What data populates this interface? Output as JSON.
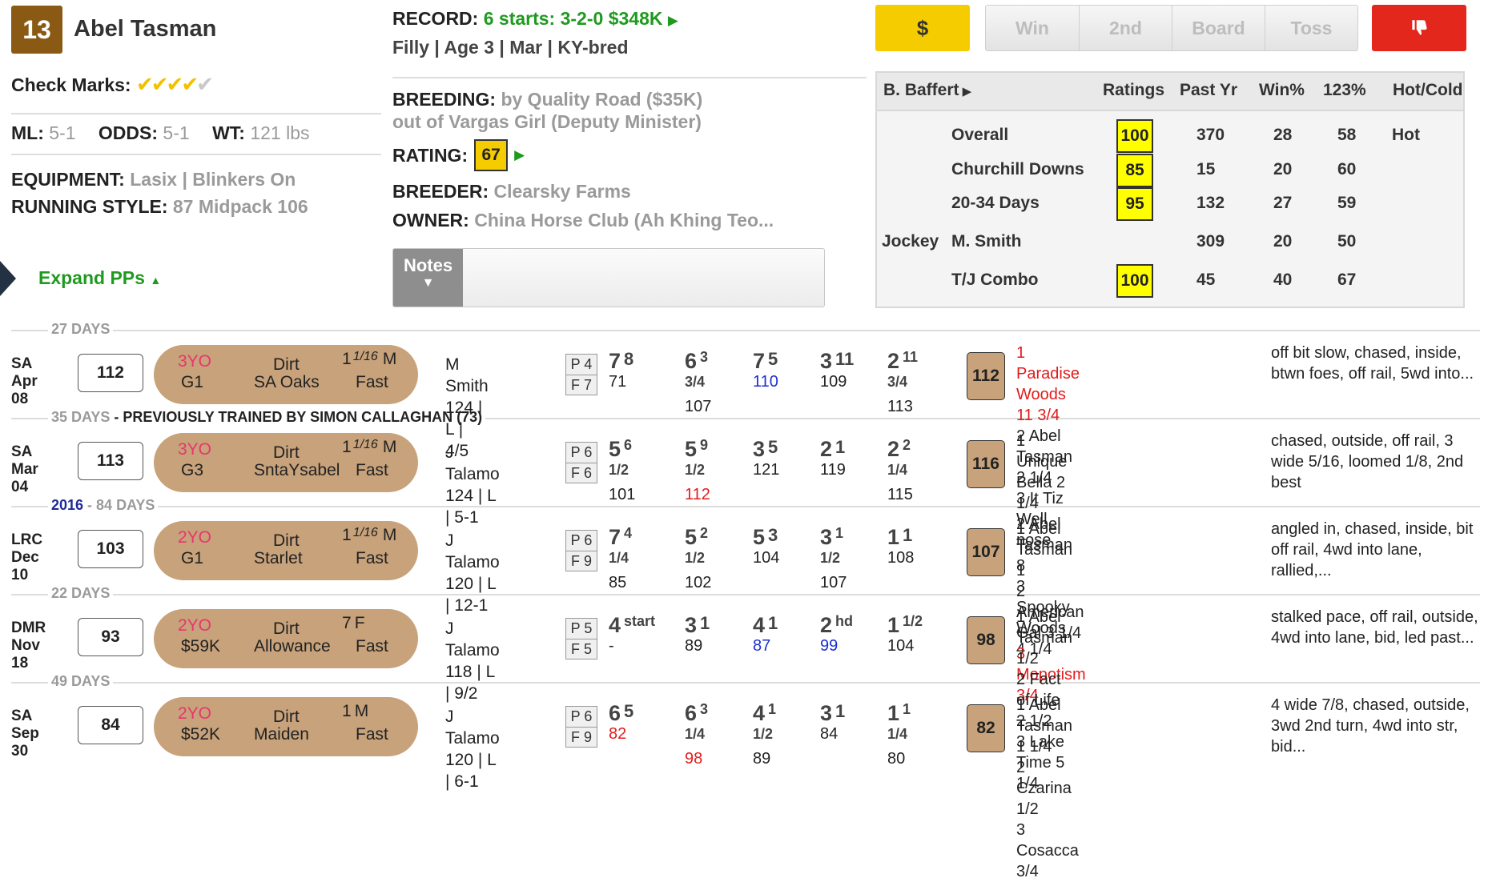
{
  "horse": {
    "post": "13",
    "name": "Abel Tasman",
    "check_marks_label": "Check Marks:",
    "ml_label": "ML:",
    "ml": "5-1",
    "odds_label": "ODDS:",
    "odds": "5-1",
    "wt_label": "WT:",
    "wt": "121 lbs",
    "equipment_label": "EQUIPMENT:",
    "equipment": "Lasix | Blinkers On",
    "running_style_label": "RUNNING STYLE:",
    "running_style": "87 Midpack 106",
    "expand_label": "Expand PPs"
  },
  "record": {
    "label": "RECORD:",
    "value": "6 starts: 3-2-0 $348K",
    "details": "Filly | Age 3 | Mar | KY-bred",
    "breeding_label": "BREEDING:",
    "breeding1": "by Quality Road ($35K)",
    "breeding2": "out of Vargas Girl (Deputy Minister)",
    "rating_label": "RATING:",
    "rating": "67",
    "breeder_label": "BREEDER:",
    "breeder": "Clearsky Farms",
    "owner_label": "OWNER:",
    "owner": "China Horse Club (Ah Khing Teo...",
    "notes_label": "Notes"
  },
  "buttons": {
    "dollar": "$",
    "win": "Win",
    "second": "2nd",
    "board": "Board",
    "toss": "Toss"
  },
  "trainer_table": {
    "trainer": "B. Baffert",
    "headers": [
      "Ratings",
      "Past Yr",
      "Win%",
      "123%",
      "Hot/Cold"
    ],
    "rows": [
      {
        "prefix": "",
        "label": "Overall",
        "rating": "100",
        "past": "370",
        "win": "28",
        "p123": "58",
        "hot": "Hot"
      },
      {
        "prefix": "",
        "label": "Churchill Downs",
        "rating": "85",
        "past": "15",
        "win": "20",
        "p123": "60",
        "hot": ""
      },
      {
        "prefix": "",
        "label": "20-34 Days",
        "rating": "95",
        "past": "132",
        "win": "27",
        "p123": "59",
        "hot": ""
      },
      {
        "prefix": "Jockey",
        "label": "M. Smith",
        "rating": "",
        "past": "309",
        "win": "20",
        "p123": "50",
        "hot": ""
      },
      {
        "prefix": "",
        "label": "T/J Combo",
        "rating": "100",
        "past": "45",
        "win": "40",
        "p123": "67",
        "hot": ""
      }
    ]
  },
  "separators": [
    {
      "days": "27 DAYS",
      "extra": ""
    },
    {
      "days": "35 DAYS",
      "extra": " - PREVIOUSLY TRAINED BY SIMON CALLAGHAN (73)"
    },
    {
      "year": "2016",
      "days": "84 DAYS",
      "extra": ""
    },
    {
      "days": "22 DAYS",
      "extra": ""
    },
    {
      "days": "49 DAYS",
      "extra": ""
    }
  ],
  "pps": [
    {
      "track": "SA",
      "date": "Apr 08",
      "speed": "112",
      "age": "3YO",
      "grade": "G1",
      "surface": "Dirt",
      "race": "SA Oaks",
      "dist_whole": "1",
      "dist_frac": "1/16",
      "dist_unit": "M",
      "cond": "Fast",
      "jockey": "M Smith",
      "jinfo": "124 | L | 4/5",
      "p": "P 4",
      "f": "F 7",
      "calls": [
        {
          "pos": "7",
          "len": "8",
          "fig": "71",
          "c": ""
        },
        {
          "pos": "6",
          "len": "3 3/4",
          "fig": "107",
          "c": ""
        },
        {
          "pos": "7",
          "len": "5",
          "fig": "110",
          "c": "blue"
        },
        {
          "pos": "3",
          "len": "11",
          "fig": "109",
          "c": ""
        },
        {
          "pos": "2",
          "len": "11 3/4",
          "fig": "113",
          "c": ""
        }
      ],
      "figure": "112",
      "results": [
        {
          "t": "1 Paradise Woods 11 3/4",
          "c": "red"
        },
        {
          "t": "2 Abel Tasman 2 1/4",
          "c": ""
        },
        {
          "t": "3 It Tiz Well nose",
          "c": ""
        }
      ],
      "comment": "off bit slow, chased, inside, btwn foes, off rail, 5wd into..."
    },
    {
      "track": "SA",
      "date": "Mar 04",
      "speed": "113",
      "age": "3YO",
      "grade": "G3",
      "surface": "Dirt",
      "race": "SntaYsabel",
      "dist_whole": "1",
      "dist_frac": "1/16",
      "dist_unit": "M",
      "cond": "Fast",
      "jockey": "J Talamo",
      "jinfo": "124 | L | 5-1",
      "p": "P 6",
      "f": "F 6",
      "calls": [
        {
          "pos": "5",
          "len": "6 1/2",
          "fig": "101",
          "c": ""
        },
        {
          "pos": "5",
          "len": "9 1/2",
          "fig": "112",
          "c": "red"
        },
        {
          "pos": "3",
          "len": "5",
          "fig": "121",
          "c": ""
        },
        {
          "pos": "2",
          "len": "1",
          "fig": "119",
          "c": ""
        },
        {
          "pos": "2",
          "len": "2 1/4",
          "fig": "115",
          "c": ""
        }
      ],
      "figure": "116",
      "results": [
        {
          "t": "1 Unique Bella 2 1/4",
          "c": ""
        },
        {
          "t": "2 Abel Tasman 8",
          "c": ""
        },
        {
          "t": "3 Spooky Woods 4 1/4",
          "c": ""
        }
      ],
      "comment": "chased, outside, off rail, 3 wide 5/16, loomed 1/8, 2nd best"
    },
    {
      "track": "LRC",
      "date": "Dec 10",
      "speed": "103",
      "age": "2YO",
      "grade": "G1",
      "surface": "Dirt",
      "race": "Starlet",
      "dist_whole": "1",
      "dist_frac": "1/16",
      "dist_unit": "M",
      "cond": "Fast",
      "jockey": "J Talamo",
      "jinfo": "120 | L | 12-1",
      "p": "P 6",
      "f": "F 9",
      "calls": [
        {
          "pos": "7",
          "len": "4 1/4",
          "fig": "85",
          "c": ""
        },
        {
          "pos": "5",
          "len": "2 1/2",
          "fig": "102",
          "c": ""
        },
        {
          "pos": "5",
          "len": "3",
          "fig": "104",
          "c": ""
        },
        {
          "pos": "3",
          "len": "1 1/2",
          "fig": "107",
          "c": ""
        },
        {
          "pos": "1",
          "len": "1",
          "fig": "108",
          "c": ""
        }
      ],
      "figure": "107",
      "results": [
        {
          "t": "1 Abel Tasman 1",
          "c": ""
        },
        {
          "t": "2 American Gal 3 1/4",
          "c": ""
        },
        {
          "t": "3 Mopotism 3/4",
          "c": "red"
        }
      ],
      "comment": "angled in, chased, inside, bit off rail, 4wd into lane, rallied,..."
    },
    {
      "track": "DMR",
      "date": "Nov 18",
      "speed": "93",
      "age": "2YO",
      "grade": "$59K",
      "surface": "Dirt",
      "race": "Allowance",
      "dist_whole": "7",
      "dist_frac": "",
      "dist_unit": "F",
      "cond": "Fast",
      "jockey": "J Talamo",
      "jinfo": "118 | L | 9/2",
      "p": "P 5",
      "f": "F 5",
      "calls": [
        {
          "pos": "4",
          "len": "start",
          "fig": "-",
          "c": ""
        },
        {
          "pos": "3",
          "len": "1",
          "fig": "89",
          "c": ""
        },
        {
          "pos": "4",
          "len": "1",
          "fig": "87",
          "c": "blue"
        },
        {
          "pos": "2",
          "len": "hd",
          "fig": "99",
          "c": "blue"
        },
        {
          "pos": "1",
          "len": "1/2",
          "fig": "104",
          "c": ""
        }
      ],
      "figure": "98",
      "results": [
        {
          "t": "1 Abel Tasman 1/2",
          "c": ""
        },
        {
          "t": "2 Fact of Life 2 1/2",
          "c": ""
        },
        {
          "t": "3 Lake Time 5 1/4",
          "c": ""
        }
      ],
      "comment": "stalked pace, off rail, outside, 4wd into lane, bid, led past..."
    },
    {
      "track": "SA",
      "date": "Sep 30",
      "speed": "84",
      "age": "2YO",
      "grade": "$52K",
      "surface": "Dirt",
      "race": "Maiden",
      "dist_whole": "1",
      "dist_frac": "",
      "dist_unit": "M",
      "cond": "Fast",
      "jockey": "J Talamo",
      "jinfo": "120 | L | 6-1",
      "p": "P 6",
      "f": "F 9",
      "calls": [
        {
          "pos": "6",
          "len": "5",
          "fig": "82",
          "c": "red"
        },
        {
          "pos": "6",
          "len": "3 1/4",
          "fig": "98",
          "c": "red"
        },
        {
          "pos": "4",
          "len": "1 1/2",
          "fig": "89",
          "c": ""
        },
        {
          "pos": "3",
          "len": "1",
          "fig": "84",
          "c": ""
        },
        {
          "pos": "1",
          "len": "1 1/4",
          "fig": "80",
          "c": ""
        }
      ],
      "figure": "82",
      "results": [
        {
          "t": "1 Abel Tasman 1 1/4",
          "c": ""
        },
        {
          "t": "2 Czarina 1/2",
          "c": ""
        },
        {
          "t": "3 Cosacca 3/4",
          "c": ""
        }
      ],
      "comment": "4 wide 7/8, chased, outside, 3wd 2nd turn, 4wd into str, bid..."
    }
  ],
  "colors": {
    "accent_green": "#1f9a1f",
    "dollar_yellow": "#f5cc00",
    "thumbs_red": "#e3271c",
    "pill_tan": "#c7a27a",
    "post_brown": "#8a5a14"
  },
  "icons": [
    "check-icon",
    "triangle-right-icon",
    "caret-up-icon",
    "caret-down-icon",
    "thumbs-down-icon",
    "collapse-arrow-icon"
  ]
}
